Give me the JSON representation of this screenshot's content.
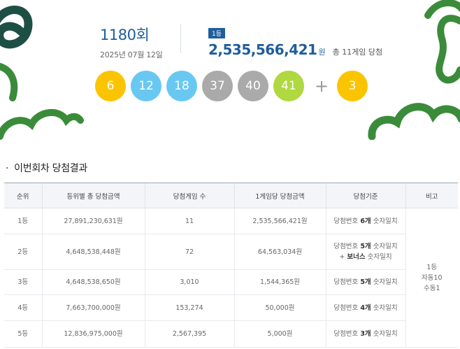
{
  "round": {
    "number": "1180",
    "suffix": "회",
    "date": "2025년 07월 12일"
  },
  "first_prize": {
    "badge": "1등",
    "amount": "2,535,566,421",
    "unit": "원",
    "note": "총 11게임 당첨"
  },
  "balls": [
    {
      "value": "6",
      "color": "#fbc400"
    },
    {
      "value": "12",
      "color": "#69c8f2"
    },
    {
      "value": "18",
      "color": "#69c8f2"
    },
    {
      "value": "37",
      "color": "#aaaaaa"
    },
    {
      "value": "40",
      "color": "#aaaaaa"
    },
    {
      "value": "41",
      "color": "#b0d840"
    }
  ],
  "plus_sign": "+",
  "bonus_ball": {
    "value": "3",
    "color": "#fbc400"
  },
  "section": {
    "bullet": "·",
    "title": "이번회차 당첨결과"
  },
  "table": {
    "headers": [
      "순위",
      "등위별 총 당첨금액",
      "당첨게임 수",
      "1게임당 당첨금액",
      "당첨기준",
      "비고"
    ],
    "rows": [
      {
        "rank": "1등",
        "total": "27,891,230,631원",
        "games": "11",
        "per_game": "2,535,566,421원",
        "criteria": {
          "pre": "당첨번호 ",
          "bold": "6개",
          "post": " 숫자일치"
        }
      },
      {
        "rank": "2등",
        "total": "4,648,538,448원",
        "games": "72",
        "per_game": "64,563,034원",
        "criteria": {
          "pre": "당첨번호 ",
          "bold": "5개",
          "post": " 숫자일치",
          "line2_pre": "+ ",
          "line2_bold": "보너스",
          "line2_post": " 숫자일치"
        }
      },
      {
        "rank": "3등",
        "total": "4,648,538,650원",
        "games": "3,010",
        "per_game": "1,544,365원",
        "criteria": {
          "pre": "당첨번호 ",
          "bold": "5개",
          "post": " 숫자일치"
        }
      },
      {
        "rank": "4등",
        "total": "7,663,700,000원",
        "games": "153,274",
        "per_game": "50,000원",
        "criteria": {
          "pre": "당첨번호 ",
          "bold": "4개",
          "post": " 숫자일치"
        }
      },
      {
        "rank": "5등",
        "total": "12,836,975,000원",
        "games": "2,567,395",
        "per_game": "5,000원",
        "criteria": {
          "pre": "당첨번호 ",
          "bold": "3개",
          "post": " 숫자일치"
        }
      }
    ],
    "note": {
      "line1": "1등",
      "line2": "자동10",
      "line3": "수동1"
    }
  },
  "colors": {
    "accent": "#1f5e9c",
    "decoration_green": "#3b8c3a",
    "decoration_dark": "#1e4f45"
  }
}
